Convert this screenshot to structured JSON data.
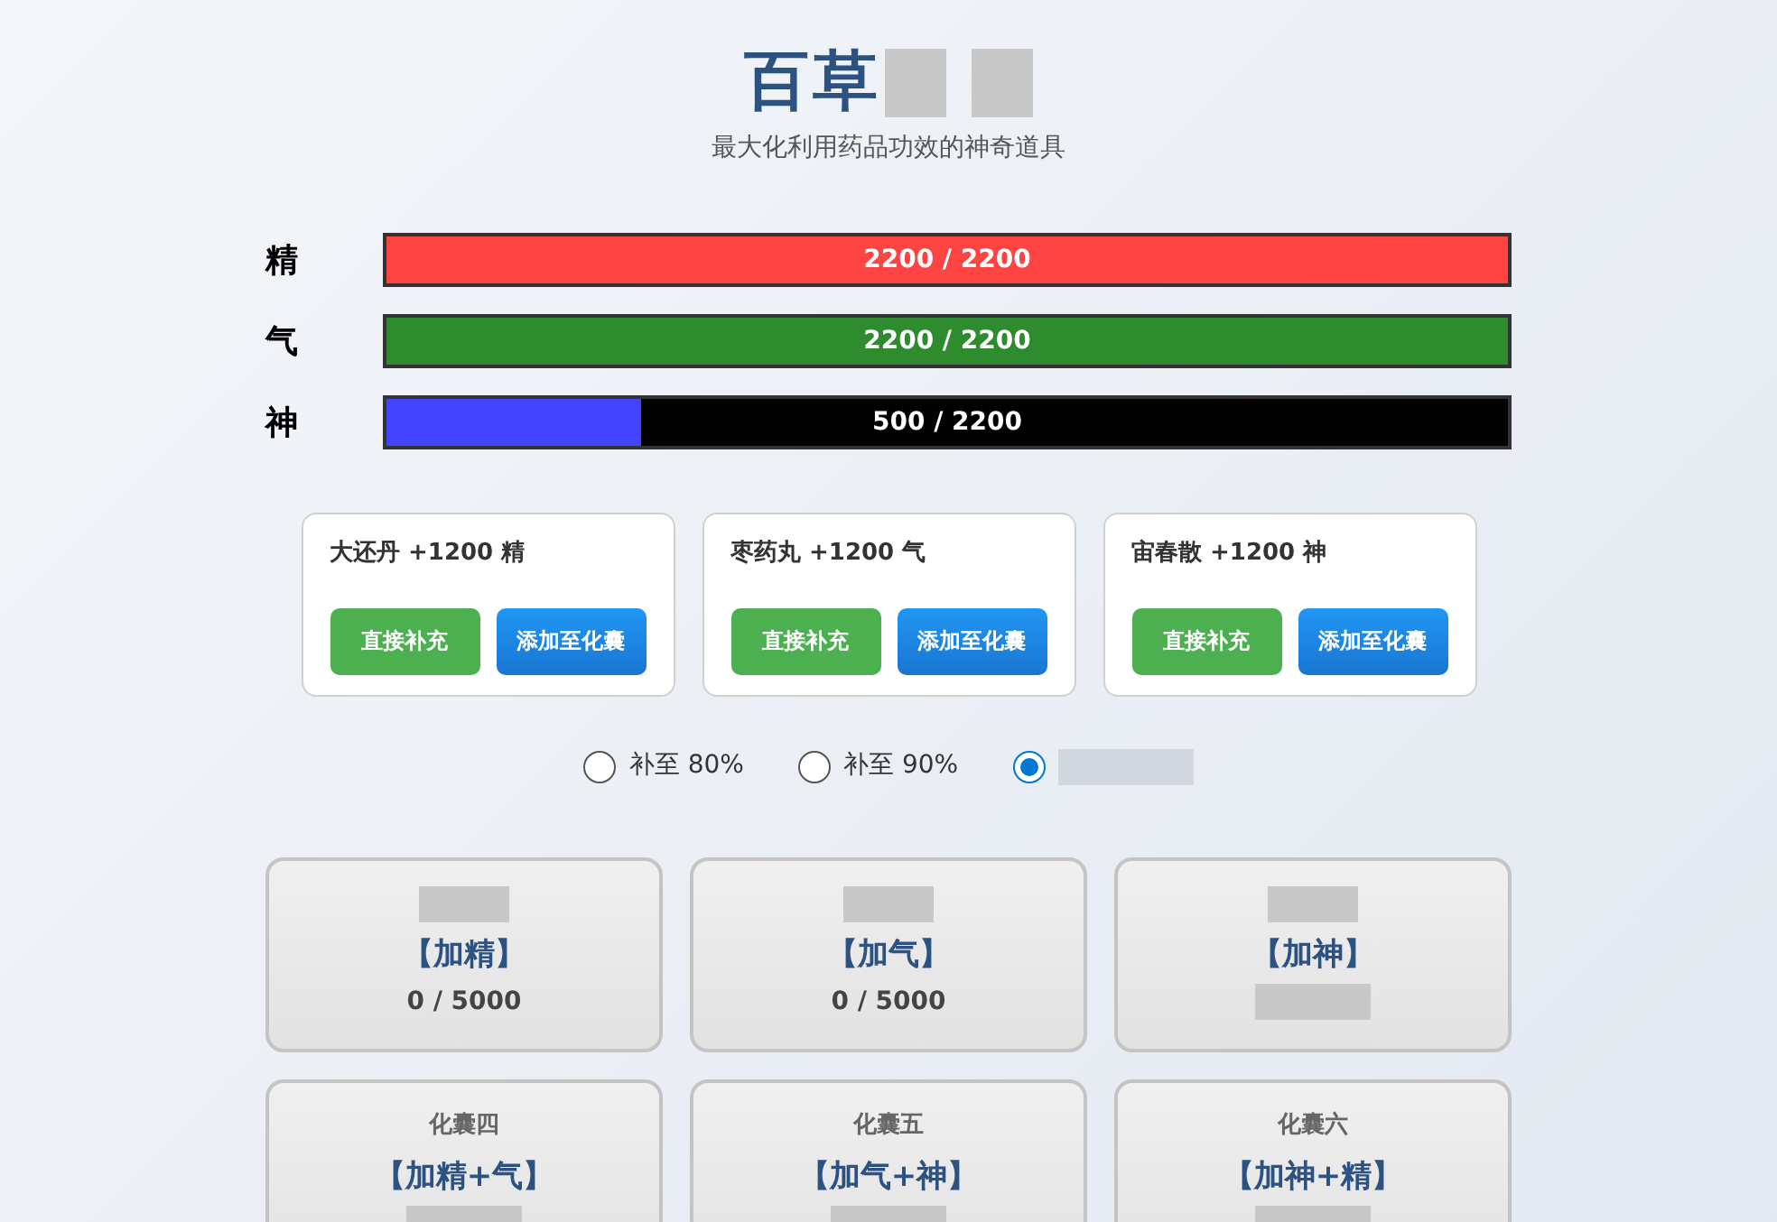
{
  "header": {
    "title": "百草",
    "subtitle": "最大化利用药品功效的神奇道具"
  },
  "stats": [
    {
      "label": "精",
      "reading": "2200 / 2200",
      "level": 1,
      "color": "#ff4444"
    },
    {
      "label": "气",
      "reading": "2200 / 2200",
      "level": 1,
      "color": "#2e8b2e"
    },
    {
      "label": "神",
      "reading": "500 / 2200",
      "level": 0.227,
      "color": "#4444ff"
    }
  ],
  "medicines": [
    {
      "name": "大还丹 +1200 精",
      "buttons": [
        "直接补充",
        "添加至化囊"
      ]
    },
    {
      "name": "枣药丸 +1200 气",
      "buttons": [
        "直接补充",
        "添加至化囊"
      ]
    },
    {
      "name": "宙春散 +1200 神",
      "buttons": [
        "直接补充",
        "添加至化囊"
      ]
    }
  ],
  "fill_options": [
    {
      "label": "补至 80%",
      "selected": false
    },
    {
      "label": "补至 90%",
      "selected": false
    },
    {
      "selected": true
    }
  ],
  "pouches": [
    {
      "effect": "【加精】",
      "reading": "0 / 5000"
    },
    {
      "effect": "【加气】",
      "reading": "0 / 5000"
    },
    {
      "effect": "【加神】"
    },
    {
      "name": "化囊四",
      "effect": "【加精+气】"
    },
    {
      "name": "化囊五",
      "effect": "【加气+神】"
    },
    {
      "name": "化囊六",
      "effect": "【加神+精】"
    }
  ]
}
